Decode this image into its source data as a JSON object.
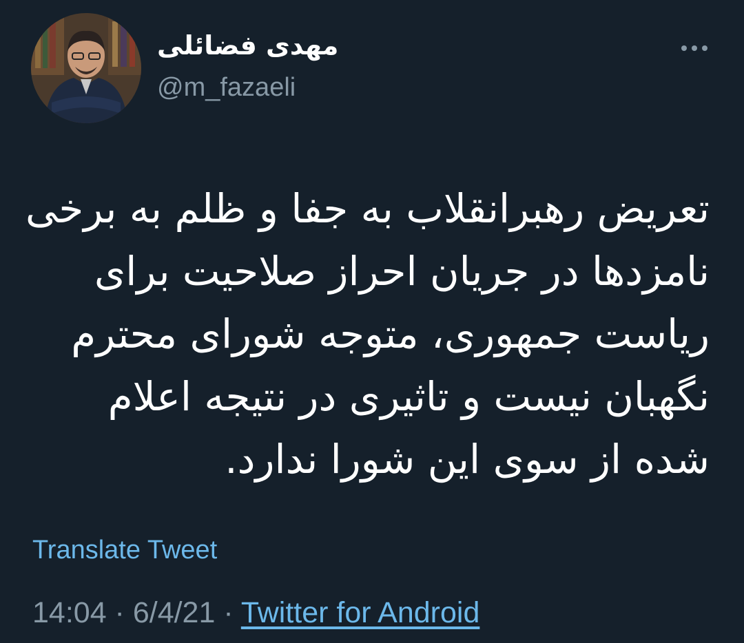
{
  "tweet": {
    "author": {
      "display_name": "مهدی فضائلی",
      "handle": "@m_fazaeli",
      "avatar_icon": "profile-photo"
    },
    "more_icon": "more-horizontal-icon",
    "text_lines": [
      "تعریض رهبرانقلاب به جفا و ظلم به برخی",
      "نامزدها در جریان احراز صلاحیت برای",
      "ریاست جمهوری، متوجه شورای محترم",
      "نگهبان نیست و تاثیری در نتیجه اعلام",
      "شده از سوی این شورا ندارد."
    ],
    "translate_label": "Translate Tweet",
    "time": "14:04",
    "separator": " · ",
    "date": "6/4/21",
    "source": "Twitter for Android"
  },
  "colors": {
    "background": "#15202b",
    "text": "#ffffff",
    "secondary": "#8899a6",
    "link": "#6cb8ea"
  }
}
